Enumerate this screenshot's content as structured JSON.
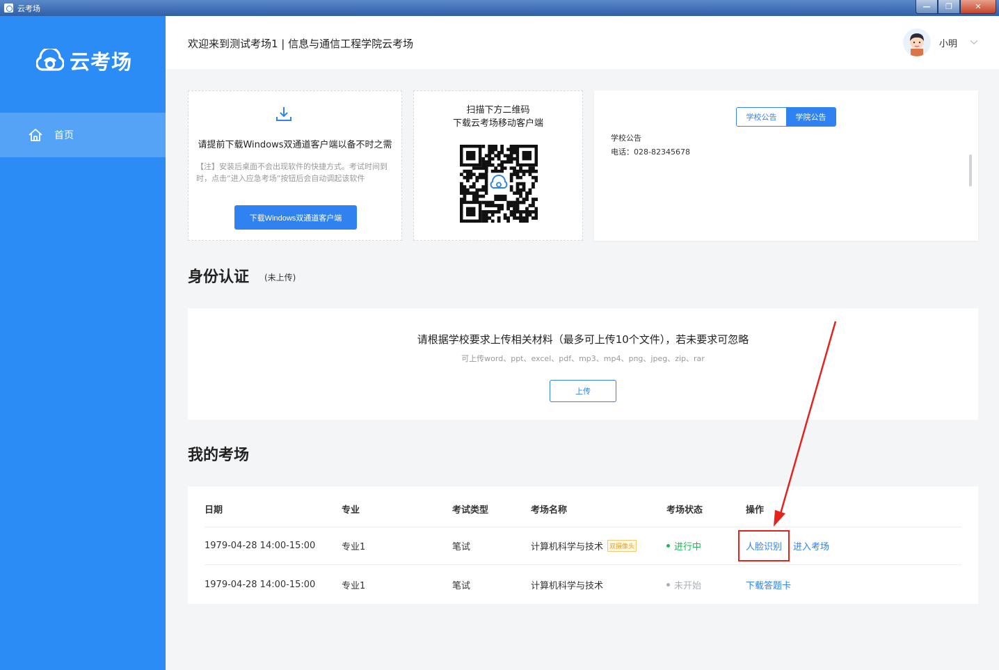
{
  "window": {
    "title": "云考场"
  },
  "sidebar": {
    "logo_text": "云考场",
    "items": [
      {
        "label": "首页"
      }
    ]
  },
  "header": {
    "welcome": "欢迎来到测试考场1 | 信息与通信工程学院云考场",
    "user_name": "小明"
  },
  "download_card": {
    "title": "请提前下载Windows双通道客户端以备不时之需",
    "note": "【注】安装后桌面不会出现软件的快捷方式。考试时间到时，点击“进入应急考场”按钮后会自动调起该软件",
    "button_label": "下载Windows双通道客户端"
  },
  "qr_card": {
    "line1": "扫描下方二维码",
    "line2": "下载云考场移动客户端"
  },
  "notice_card": {
    "tabs": [
      {
        "label": "学校公告"
      },
      {
        "label": "学院公告"
      }
    ],
    "active_tab": 1,
    "line1": "学校公告",
    "line2": "电话：028-82345678"
  },
  "identity": {
    "title": "身份认证",
    "status": "(未上传)",
    "instruction": "请根据学校要求上传相关材料（最多可上传10个文件），若未要求可忽略",
    "formats": "可上传word、ppt、excel、pdf、mp3、mp4、png、jpeg、zip、rar",
    "upload_label": "上传"
  },
  "exams": {
    "title": "我的考场",
    "columns": [
      "日期",
      "专业",
      "考试类型",
      "考场名称",
      "考场状态",
      "操作"
    ],
    "rows": [
      {
        "date": "1979-04-28  14:00-15:00",
        "major": "专业1",
        "type": "笔试",
        "name": "计算机科学与技术",
        "badge": "双摄像头",
        "status": "进行中",
        "actions": [
          "人脸识别",
          "进入考场"
        ]
      },
      {
        "date": "1979-04-28  14:00-15:00",
        "major": "专业1",
        "type": "笔试",
        "name": "计算机科学与技术",
        "badge": "",
        "status": "未开始",
        "actions": [
          "下载答题卡"
        ]
      }
    ]
  },
  "colors": {
    "sidebar": "#2a8cf4",
    "primary": "#2f82ef",
    "status_active": "#19b955",
    "status_inactive": "#aab0b8",
    "annotation": "#e3231c"
  }
}
